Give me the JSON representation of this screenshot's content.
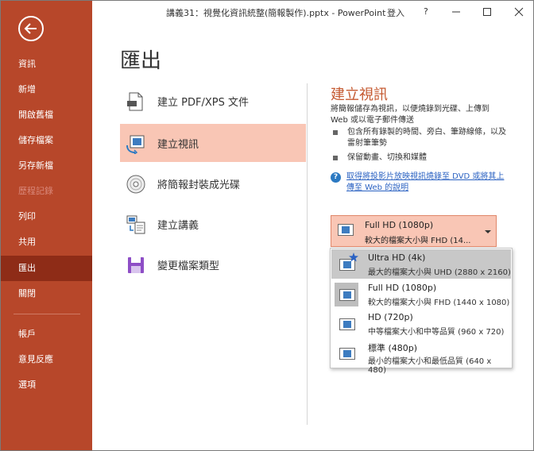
{
  "window": {
    "title": "講義31：視覺化資訊統整(簡報製作).pptx  -  PowerPoint",
    "signin": "登入",
    "help": "?"
  },
  "sidebar": {
    "items": [
      {
        "label": "資訊"
      },
      {
        "label": "新增"
      },
      {
        "label": "開啟舊檔"
      },
      {
        "label": "儲存檔案"
      },
      {
        "label": "另存新檔"
      },
      {
        "label": "歷程記錄"
      },
      {
        "label": "列印"
      },
      {
        "label": "共用"
      },
      {
        "label": "匯出"
      },
      {
        "label": "關閉"
      },
      {
        "label": "帳戶"
      },
      {
        "label": "意見反應"
      },
      {
        "label": "選項"
      }
    ]
  },
  "main": {
    "title": "匯出",
    "options": [
      {
        "label": "建立 PDF/XPS 文件",
        "icon": "pdf-document-icon"
      },
      {
        "label": "建立視訊",
        "icon": "video-icon"
      },
      {
        "label": "將簡報封裝成光碟",
        "icon": "cd-icon"
      },
      {
        "label": "建立講義",
        "icon": "handout-icon"
      },
      {
        "label": "變更檔案類型",
        "icon": "file-type-icon"
      }
    ]
  },
  "panel": {
    "title": "建立視訊",
    "description": "將簡報儲存為視訊，以便燒錄到光碟、上傳到 Web 或以電子郵件傳送",
    "bullets": [
      "包含所有錄製的時間、旁白、筆跡線條，以及雷射筆筆勢",
      "保留動畫、切換和媒體"
    ],
    "help_link": "取得將投影片放映視訊燒錄至 DVD 或將其上傳至 Web 的說明"
  },
  "resolution": {
    "selected": {
      "name": "Full HD (1080p)",
      "detail": "較大的檔案大小與 FHD (14..."
    },
    "options": [
      {
        "name": "Ultra HD (4k)",
        "detail": "最大的檔案大小與 UHD (2880 x 2160)"
      },
      {
        "name": "Full HD (1080p)",
        "detail": "較大的檔案大小與 FHD (1440 x 1080)"
      },
      {
        "name": "HD (720p)",
        "detail": "中等檔案大小和中等品質 (960 x 720)"
      },
      {
        "name": "標準 (480p)",
        "detail": "最小的檔案大小和最低品質 (640 x 480)"
      }
    ]
  },
  "colors": {
    "sidebar": "#b7472a",
    "sidebar_active": "#8e2c17",
    "selected_option": "#f9c6b5",
    "accent_text": "#c55a31",
    "link": "#2b62c2"
  }
}
